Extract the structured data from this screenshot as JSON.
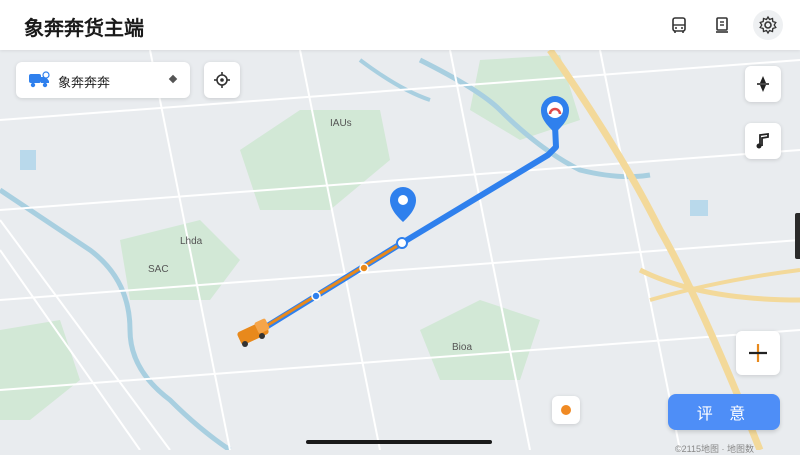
{
  "header": {
    "title": "象奔奔货主端",
    "icons": [
      "bus-icon",
      "document-icon",
      "gear-icon"
    ]
  },
  "vehicle_selector": {
    "name": "象奔奔奔",
    "icon": "truck-icon"
  },
  "map": {
    "labels": [
      "IAUs",
      "Lhda",
      "SAC",
      "Bioa"
    ],
    "route_color": "#2f80ed",
    "progress_color": "#e8891c",
    "start_label": "",
    "destination_icon": "location-pin-icon"
  },
  "controls": {
    "right": [
      "compass-icon",
      "music-icon",
      "locate-icon"
    ],
    "locate_small": "locate-dot-icon"
  },
  "confirm_button": {
    "label": "评 意"
  },
  "footnote": "©2115地图 · 地图数"
}
